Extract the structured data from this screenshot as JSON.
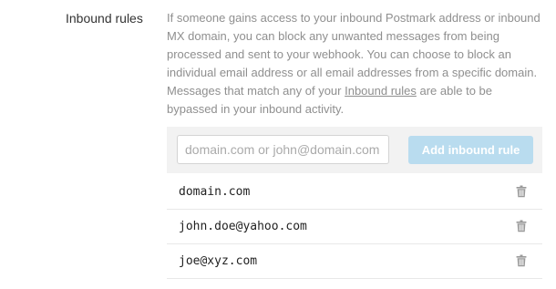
{
  "section": {
    "label": "Inbound rules"
  },
  "description": {
    "before_link": "If someone gains access to your inbound Postmark address or inbound MX domain, you can block any unwanted messages from being processed and sent to your webhook. You can choose to block an individual email address or all email addresses from a specific domain. Messages that match any of your ",
    "link_text": "Inbound rules",
    "after_link": " are able to be bypassed in your inbound activity."
  },
  "add_rule": {
    "placeholder": "domain.com or john@domain.com",
    "value": "",
    "button_label": "Add inbound rule"
  },
  "rules": [
    {
      "value": "domain.com",
      "icon": "trash-icon"
    },
    {
      "value": "john.doe@yahoo.com",
      "icon": "trash-icon"
    },
    {
      "value": "joe@xyz.com",
      "icon": "trash-icon"
    }
  ],
  "colors": {
    "button_bg": "#b9dcef",
    "panel_bg": "#f2f2f2",
    "muted_text": "#8f8f8f"
  }
}
